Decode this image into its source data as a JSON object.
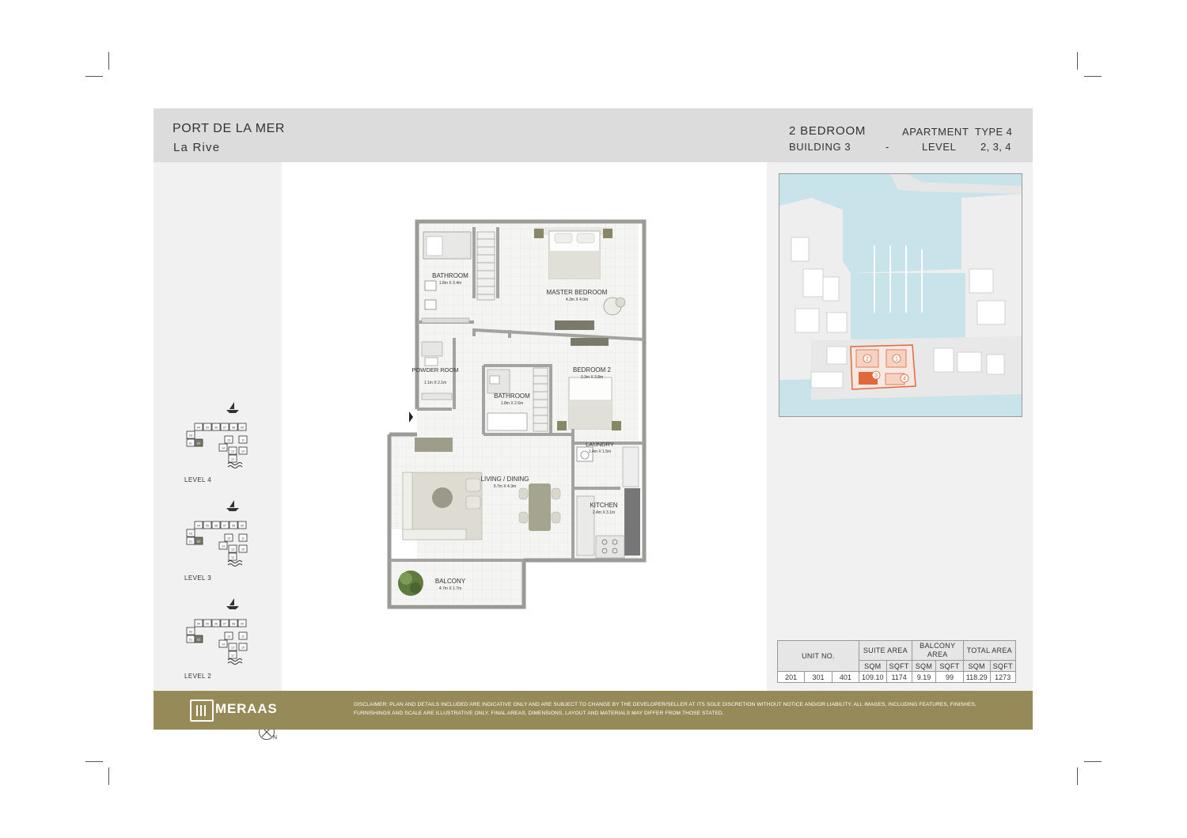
{
  "header": {
    "project": "PORT DE LA MER",
    "development": "La Rive",
    "bedrooms": "2 BEDROOM",
    "building": "BUILDING 3",
    "separator": "-",
    "apartment_label": "APARTMENT",
    "type_label": "TYPE 4",
    "level_label": "LEVEL",
    "levels": "2, 3, 4"
  },
  "key_plans": [
    {
      "label": "LEVEL 4"
    },
    {
      "label": "LEVEL 3"
    },
    {
      "label": "LEVEL 2"
    }
  ],
  "key_plan_units": [
    "04",
    "05",
    "06",
    "07",
    "08",
    "09",
    "03",
    "01",
    "02",
    "15",
    "14",
    "13",
    "12",
    "11",
    "10"
  ],
  "compass": {
    "label": "N"
  },
  "floor_plan": {
    "rooms": [
      {
        "name": "BATHROOM",
        "size": "1.8m X 3.4m"
      },
      {
        "name": "MASTER BEDROOM",
        "size": "4.3m X 4.0m"
      },
      {
        "name": "POWDER ROOM",
        "size": "1.1m X 2.1m"
      },
      {
        "name": "BEDROOM 2",
        "size": "3.3m X 3.8m"
      },
      {
        "name": "BATHROOM",
        "size": "1.8m X 2.6m"
      },
      {
        "name": "LAUNDRY",
        "size": "1.4m X 1.5m"
      },
      {
        "name": "LIVING / DINING",
        "size": "6.7m X 4.3m"
      },
      {
        "name": "KITCHEN",
        "size": "2.4m X 3.1m"
      },
      {
        "name": "BALCONY",
        "size": "4.7m X 1.7m"
      }
    ]
  },
  "site_map": {
    "building_markers": [
      "2",
      "1",
      "3",
      "4"
    ],
    "colors": {
      "water": "#c8e4ea",
      "land": "#eeeeee",
      "highlight": "#e0683a"
    }
  },
  "area_table": {
    "unit_header": "UNIT NO.",
    "suite_header": "SUITE AREA",
    "balcony_header": "BALCONY AREA",
    "total_header": "TOTAL AREA",
    "sqm": "SQM",
    "sqft": "SQFT",
    "units": [
      "201",
      "301",
      "401"
    ],
    "suite_sqm": "109.10",
    "suite_sqft": "1174",
    "balcony_sqm": "9.19",
    "balcony_sqft": "99",
    "total_sqm": "118.29",
    "total_sqft": "1273"
  },
  "footer": {
    "brand": "MERAAS",
    "disclaimer": "DISCLAIMER: PLAN AND DETAILS INCLUDED ARE INDICATIVE ONLY AND ARE SUBJECT TO CHANGE BY THE DEVELOPER/SELLER AT ITS SOLE DISCRETION WITHOUT NOTICE AND/OR LIABILITY. ALL IMAGES, INCLUDING FEATURES, FINISHES, FURNISHINGS AND SCALE ARE ILLUSTRATIVE ONLY. FINAL AREAS, DIMENSIONS, LAYOUT AND MATERIALS MAY DIFFER FROM THOSE STATED.",
    "color": "#968a58"
  }
}
